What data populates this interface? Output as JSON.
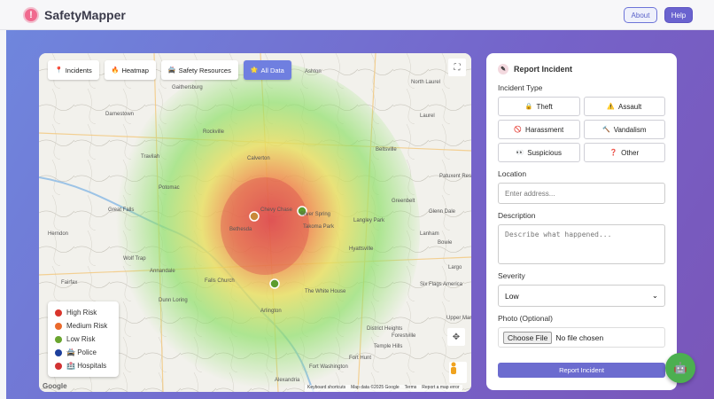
{
  "header": {
    "app_name": "SafetyMapper",
    "logo_glyph": "!",
    "about_label": "About",
    "help_label": "Help"
  },
  "map": {
    "tabs": [
      {
        "icon": "📍",
        "label": "Incidents"
      },
      {
        "icon": "🔥",
        "label": "Heatmap"
      },
      {
        "icon": "🚔",
        "label": "Safety Resources"
      },
      {
        "icon": "🌟",
        "label": "All Data"
      }
    ],
    "place_labels": [
      "Germantown",
      "Gaithersburg",
      "Ashton",
      "North Laurel",
      "Darnestown",
      "Rockville",
      "Laurel",
      "Travilah",
      "Calverton",
      "Beltsville",
      "Great Falls",
      "Bethesda",
      "Chevy Chase",
      "Silver Spring",
      "Greenbelt",
      "Herndon",
      "Wolf Trap",
      "Takoma Park",
      "Hyattsville",
      "Arlington",
      "Alexandria",
      "The White House",
      "Potomac",
      "Fort Hunt",
      "Annandale",
      "Dunn Loring",
      "Falls Church",
      "Fort Washington",
      "Lanham",
      "Bowie",
      "Patuxent Research Refuge",
      "Glenn Dale",
      "Six Flags America",
      "Temple Hills",
      "Forestville",
      "District Heights",
      "Largo",
      "Upper Marlboro",
      "Langley Park",
      "Fairfax"
    ],
    "legend": [
      {
        "label": "High Risk",
        "color": "#d9352c"
      },
      {
        "label": "Medium Risk",
        "color": "#ea6a2c"
      },
      {
        "label": "Low Risk",
        "color": "#6aa52f"
      },
      {
        "label": "Police",
        "icon": "🚔",
        "color": "#1d3f9c"
      },
      {
        "label": "Hospitals",
        "icon": "🏥",
        "color": "#d13333"
      }
    ],
    "attribution": [
      "Keyboard shortcuts",
      "Map data ©2025 Google",
      "Terms",
      "Report a map error"
    ],
    "google_logo": "Google"
  },
  "panel": {
    "title": "Report Incident",
    "incident_type_label": "Incident Type",
    "types": [
      {
        "icon": "🔒",
        "label": "Theft"
      },
      {
        "icon": "⚠️",
        "label": "Assault"
      },
      {
        "icon": "🚫",
        "label": "Harassment"
      },
      {
        "icon": "🔨",
        "label": "Vandalism"
      },
      {
        "icon": "👀",
        "label": "Suspicious"
      },
      {
        "icon": "❓",
        "label": "Other"
      }
    ],
    "location_label": "Location",
    "location_placeholder": "Enter address...",
    "description_label": "Description",
    "description_placeholder": "Describe what happened...",
    "severity_label": "Severity",
    "severity_value": "Low",
    "photo_label": "Photo (Optional)",
    "choose_file": "Choose File",
    "no_file": "No file chosen",
    "submit_label": "Report Incident"
  }
}
